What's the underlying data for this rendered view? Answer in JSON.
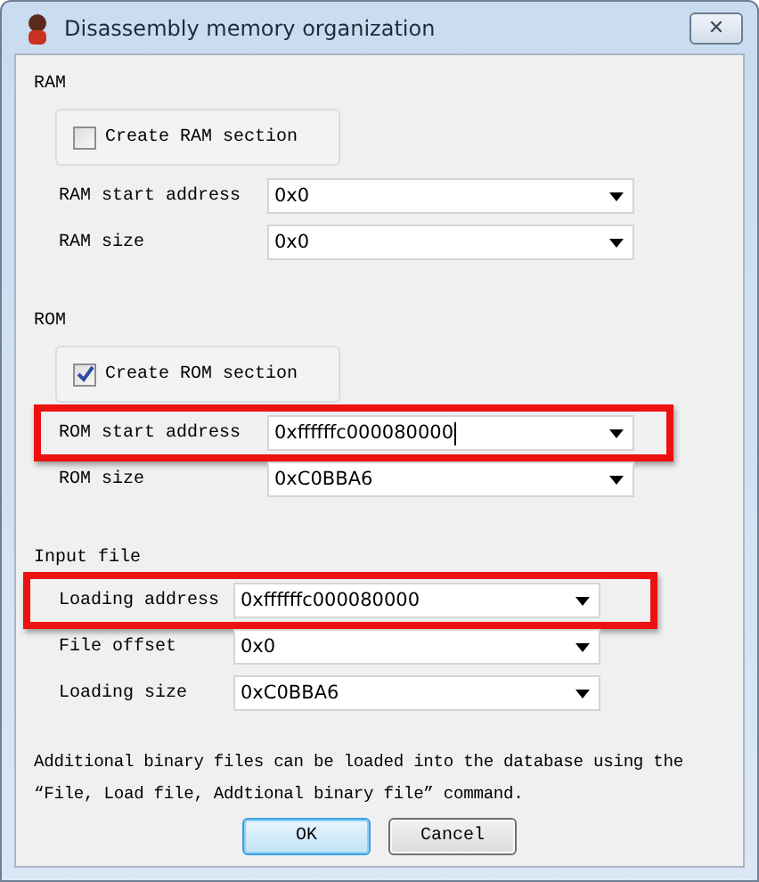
{
  "window": {
    "title": "Disassembly memory organization",
    "close": "✕"
  },
  "sections": [
    {
      "kind": "memory",
      "title": "RAM",
      "checkbox": {
        "label": "Create RAM section",
        "checked": false
      },
      "rows": [
        {
          "label": "RAM start address",
          "value": "0x0",
          "highlighted": false,
          "caret": false
        },
        {
          "label": "RAM size",
          "value": "0x0",
          "highlighted": false,
          "caret": false
        }
      ]
    },
    {
      "kind": "memory",
      "title": "ROM",
      "checkbox": {
        "label": "Create ROM section",
        "checked": true
      },
      "rows": [
        {
          "label": "ROM start address",
          "value": "0xffffffc000080000",
          "highlighted": true,
          "caret": true
        },
        {
          "label": "ROM size",
          "value": "0xC0BBA6",
          "highlighted": false,
          "caret": false
        }
      ]
    },
    {
      "kind": "file",
      "title": "Input file",
      "rows": [
        {
          "label": "Loading address",
          "value": "0xffffffc000080000",
          "highlighted": true,
          "caret": false
        },
        {
          "label": "File offset",
          "value": "0x0",
          "highlighted": false,
          "caret": false
        },
        {
          "label": "Loading size",
          "value": "0xC0BBA6",
          "highlighted": false,
          "caret": false
        }
      ]
    }
  ],
  "note": "Additional binary files can be loaded into the database using the “File, Load file, Addtional binary file” command.",
  "buttons": [
    {
      "label": "OK",
      "default": true
    },
    {
      "label": "Cancel",
      "default": false
    }
  ]
}
